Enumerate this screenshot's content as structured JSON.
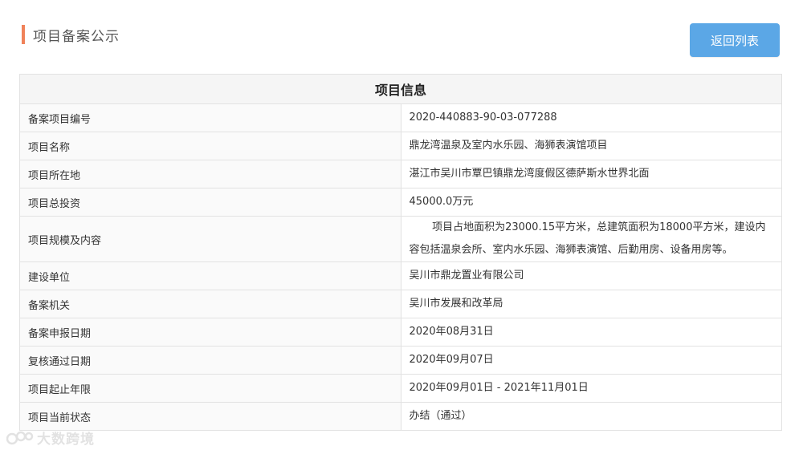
{
  "header": {
    "title": "项目备案公示",
    "back_label": "返回列表"
  },
  "table": {
    "heading": "项目信息",
    "rows": [
      {
        "label": "备案项目编号",
        "value": "2020-440883-90-03-077288"
      },
      {
        "label": "项目名称",
        "value": "鼎龙湾温泉及室内水乐园、海狮表演馆项目"
      },
      {
        "label": "项目所在地",
        "value": "湛江市吴川市覃巴镇鼎龙湾度假区德萨斯水世界北面"
      },
      {
        "label": "项目总投资",
        "value": "45000.0万元"
      },
      {
        "label": "项目规模及内容",
        "value": "项目占地面积为23000.15平方米，总建筑面积为18000平方米，建设内容包括温泉会所、室内水乐园、海狮表演馆、后勤用房、设备用房等。"
      },
      {
        "label": "建设单位",
        "value": "吴川市鼎龙置业有限公司"
      },
      {
        "label": "备案机关",
        "value": "吴川市发展和改革局"
      },
      {
        "label": "备案申报日期",
        "value": "2020年08月31日"
      },
      {
        "label": "复核通过日期",
        "value": "2020年09月07日"
      },
      {
        "label": "项目起止年限",
        "value": "2020年09月01日 - 2021年11月01日"
      },
      {
        "label": "项目当前状态",
        "value": "办结（通过）"
      }
    ]
  },
  "watermark": {
    "text": "大数跨境",
    "icon": "logo-icon"
  },
  "colors": {
    "accent": "#f0825a",
    "button": "#5ba7e6"
  }
}
